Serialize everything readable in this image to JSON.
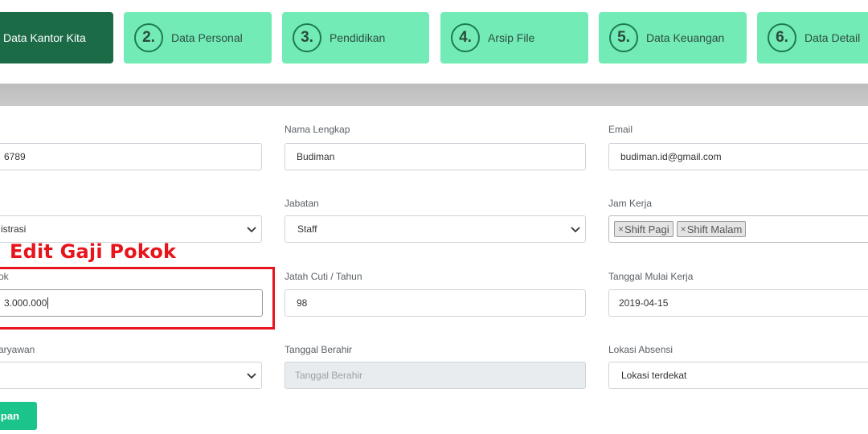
{
  "steps": [
    {
      "number": "",
      "label": "Data Kantor Kita",
      "active": true
    },
    {
      "number": "2.",
      "label": "Data Personal",
      "active": false
    },
    {
      "number": "3.",
      "label": "Pendidikan",
      "active": false
    },
    {
      "number": "4.",
      "label": "Arsip File",
      "active": false
    },
    {
      "number": "5.",
      "label": "Data Keuangan",
      "active": false
    },
    {
      "number": "6.",
      "label": "Data Detail",
      "active": false
    }
  ],
  "form": {
    "id_value": "6789",
    "nama_label": "Nama Lengkap",
    "nama_value": "Budiman",
    "email_label": "Email",
    "email_value": "budiman.id@gmail.com",
    "divisi_value": "istrasi",
    "jabatan_label": "Jabatan",
    "jabatan_value": "Staff",
    "jam_label": "Jam Kerja",
    "jam_tags": [
      "Shift Pagi",
      "Shift Malam"
    ],
    "gaji_label": "ok",
    "gaji_value": "3.000.000",
    "cuti_label": "Jatah Cuti / Tahun",
    "cuti_value": "98",
    "mulai_label": "Tanggal Mulai Kerja",
    "mulai_value": "2019-04-15",
    "status_label": "aryawan",
    "berakhir_label": "Tanggal Berahir",
    "berakhir_placeholder": "Tanggal Berahir",
    "lokasi_label": "Lokasi Absensi",
    "lokasi_value": "Lokasi terdekat",
    "save_label": "pan"
  },
  "annotation": {
    "text": "Edit Gaji Pokok",
    "color": "#e8141c"
  },
  "colors": {
    "step_bg": "#72ebb6",
    "step_active_bg": "#1b6b47",
    "save_button": "#1bc48a"
  },
  "icons": {
    "select_arrow": "chevron-down-icon",
    "tag_remove": "×"
  }
}
